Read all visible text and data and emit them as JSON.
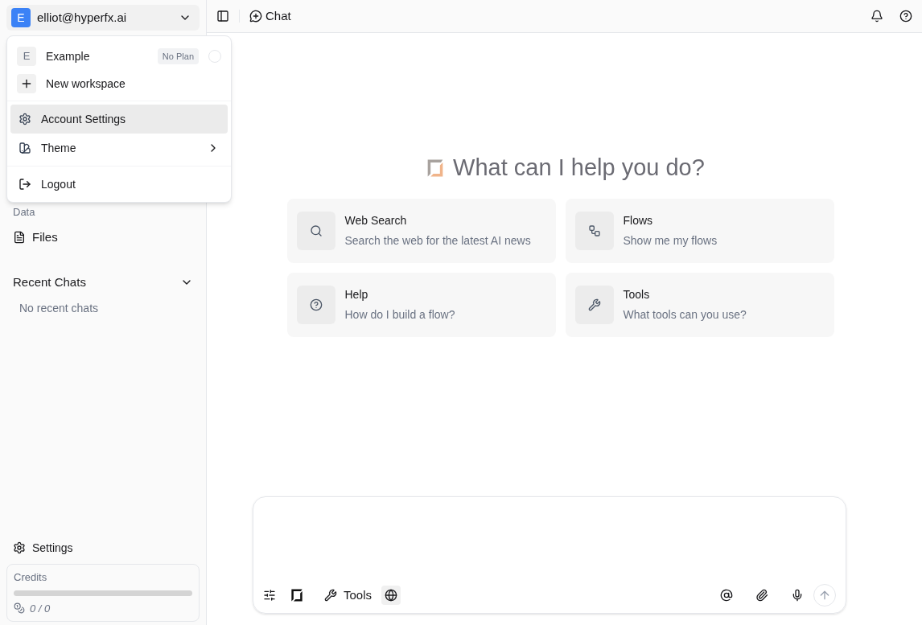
{
  "account": {
    "avatar": "E",
    "email": "elliot@hyperfx.ai"
  },
  "header": {
    "title": "Chat"
  },
  "account_menu": {
    "workspaces": [
      {
        "avatar": "E",
        "name": "Example",
        "badge": "No Plan",
        "checked": false
      }
    ],
    "new_workspace": "New workspace",
    "items": [
      {
        "kind": "settings",
        "label": "Account Settings",
        "selected": true
      },
      {
        "kind": "theme",
        "label": "Theme",
        "selected": false
      }
    ],
    "logout": "Logout"
  },
  "sidebar": {
    "section_label": "Data",
    "items": [
      {
        "label": "Files"
      }
    ],
    "recent_chats": {
      "title": "Recent Chats",
      "expanded": true,
      "empty": "No recent chats"
    },
    "settings": "Settings",
    "credits": {
      "label": "Credits",
      "level": 0,
      "reading": "0 / 0"
    }
  },
  "heading": "What can I help you do?",
  "suggestions": [
    {
      "kind": "search",
      "title": "Web Search",
      "subtitle": "Search the web for the latest AI news"
    },
    {
      "kind": "flows",
      "title": "Flows",
      "subtitle": "Show me my flows"
    },
    {
      "kind": "help",
      "title": "Help",
      "subtitle": "How do I build a flow?"
    },
    {
      "kind": "tools",
      "title": "Tools",
      "subtitle": "What tools can you use?"
    }
  ],
  "composer": {
    "tools_label": "Tools",
    "web_on": true
  }
}
